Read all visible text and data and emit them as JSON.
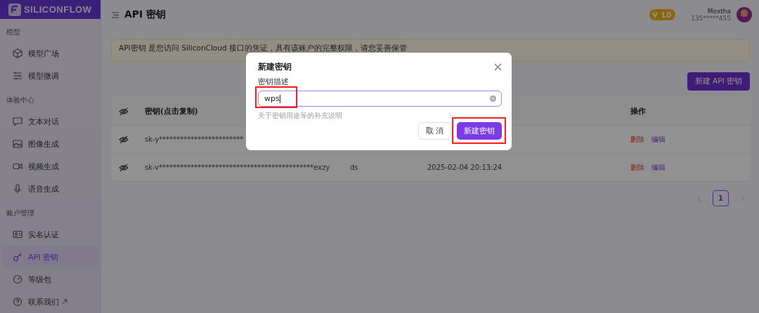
{
  "brand": {
    "name": "SILICONFLOW"
  },
  "header": {
    "title": "API 密钥",
    "level_badge": "L0",
    "user_name": "Mextha",
    "user_phone": "135*****455"
  },
  "sidebar": {
    "groups": [
      {
        "label": "模型",
        "items": [
          {
            "label": "模型广场",
            "kind": "cube",
            "selected": false,
            "external": false
          },
          {
            "label": "模型微调",
            "kind": "sliders",
            "selected": false,
            "external": false
          }
        ]
      },
      {
        "label": "体验中心",
        "items": [
          {
            "label": "文本对话",
            "kind": "chat",
            "selected": false,
            "external": false
          },
          {
            "label": "图像生成",
            "kind": "image",
            "selected": false,
            "external": false
          },
          {
            "label": "视频生成",
            "kind": "video",
            "selected": false,
            "external": false
          },
          {
            "label": "语音生成",
            "kind": "mic",
            "selected": false,
            "external": false
          }
        ]
      },
      {
        "label": "账户管理",
        "items": [
          {
            "label": "实名认证",
            "kind": "idcard",
            "selected": false,
            "external": false
          },
          {
            "label": "API 密钥",
            "kind": "key",
            "selected": true,
            "external": false
          },
          {
            "label": "等级包",
            "kind": "gauge",
            "selected": false,
            "external": false
          },
          {
            "label": "联系我们",
            "kind": "help",
            "selected": false,
            "external": true
          }
        ]
      }
    ]
  },
  "notice": "API密钥 是您访问 SiliconCloud 接口的凭证，具有该账户的完整权限，请您妥善保管",
  "create_button": "新建 API 密钥",
  "table": {
    "columns": [
      {
        "kind": "eye"
      },
      {
        "kind": "text",
        "label": "密钥(点击复制)"
      },
      {
        "kind": "hidden"
      },
      {
        "kind": "hidden"
      },
      {
        "kind": "text",
        "label": "操作"
      }
    ],
    "rows": [
      {
        "key": "sk-y************************",
        "actions": [
          "删除",
          "编辑"
        ]
      },
      {
        "key": "sk-v********************************************exzy",
        "column_3": "ds",
        "column_4": "2025-02-04 20:13:24",
        "actions": [
          "删除",
          "编辑"
        ]
      }
    ]
  },
  "pagination": {
    "pages": [
      {
        "label": "1",
        "selected": true
      }
    ]
  },
  "modal": {
    "title": "新建密钥",
    "field_label": "密钥描述",
    "value": "wps",
    "help": "关于密钥用途等的补充说明",
    "cancel": "取 消",
    "submit": "新建密钥",
    "field_highlighted": true,
    "submit_highlighted": true
  }
}
